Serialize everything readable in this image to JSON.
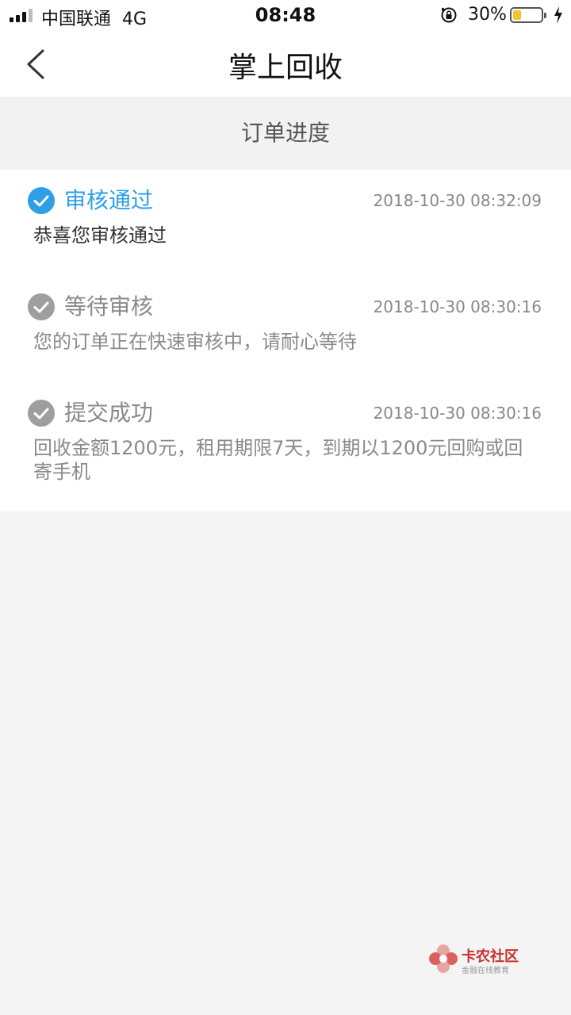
{
  "status_bar": {
    "carrier": "中国联通",
    "network": "4G",
    "time": "08:48",
    "battery_percent": "30%",
    "battery_level": 0.3,
    "icons": [
      "signal-icon",
      "orientation-lock-icon",
      "battery-icon",
      "charging-bolt-icon"
    ]
  },
  "nav": {
    "title": "掌上回收",
    "back_icon": "chevron-left-icon"
  },
  "section_header": "订单进度",
  "timeline": [
    {
      "title": "审核通过",
      "time": "2018-10-30 08:32:09",
      "description": "恭喜您审核通过",
      "status": "active"
    },
    {
      "title": "等待审核",
      "time": "2018-10-30 08:30:16",
      "description": "您的订单正在快速审核中，请耐心等待",
      "status": "done"
    },
    {
      "title": "提交成功",
      "time": "2018-10-30 08:30:16",
      "description": "回收金额1200元，租用期限7天，到期以1200元回购或回寄手机",
      "status": "done"
    }
  ],
  "colors": {
    "active": "#2e9fe6",
    "inactive": "#9e9e9e",
    "text_dark": "#333333",
    "text_muted": "#8a8a8a",
    "battery": "#f5c22c"
  },
  "watermark": {
    "name": "卡农社区",
    "subtitle": "金融在线教育"
  }
}
